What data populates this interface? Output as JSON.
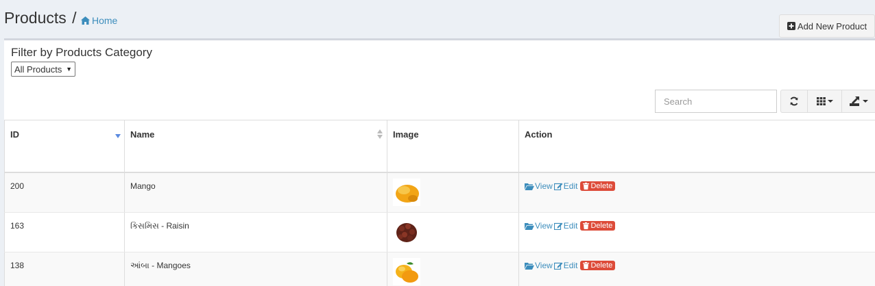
{
  "header": {
    "title": "Products",
    "separator": "/",
    "breadcrumb_home": "Home",
    "add_button_label": "Add New Product"
  },
  "filter": {
    "label": "Filter by Products Category",
    "selected": "All Products"
  },
  "toolbar": {
    "search_placeholder": "Search",
    "icons": [
      "refresh-icon",
      "columns-grid-icon",
      "export-icon"
    ]
  },
  "table": {
    "columns": [
      "ID",
      "Name",
      "Image",
      "Action"
    ],
    "rows": [
      {
        "id": "200",
        "name": "Mango",
        "image": "mango-thumbnail"
      },
      {
        "id": "163",
        "name": "કિસમિસ - Raisin",
        "image": "raisin-thumbnail"
      },
      {
        "id": "138",
        "name": "આંબા - Mangoes",
        "image": "mangoes-thumbnail"
      }
    ],
    "actions": {
      "view": "View",
      "edit": "Edit",
      "delete": "Delete"
    }
  },
  "colors": {
    "link": "#3c8dbc",
    "danger": "#dd4b39",
    "sort_active": "#5b8ae0"
  }
}
